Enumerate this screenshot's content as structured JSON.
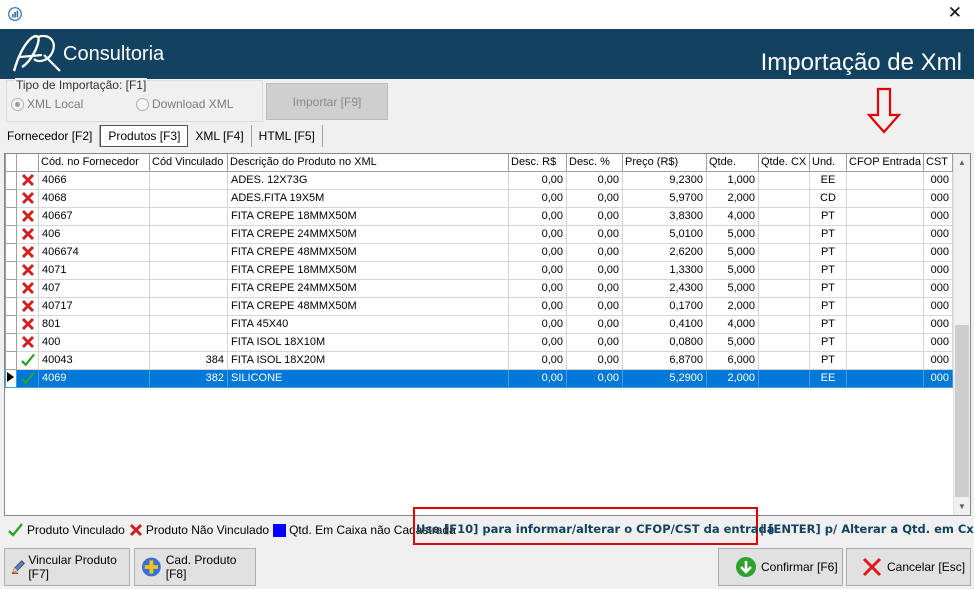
{
  "window": {
    "close_glyph": "✕"
  },
  "banner": {
    "brand": "Consultoria",
    "title": "Importação de Xml"
  },
  "import_group": {
    "legend": "Tipo de Importação: [F1]",
    "options": [
      "XML Local",
      "Download XML"
    ],
    "selected": "XML Local",
    "button": "Importar [F9]"
  },
  "tabs": [
    "Fornecedor [F2]",
    "Produtos [F3]",
    "XML [F4]",
    "HTML [F5]"
  ],
  "active_tab": "Produtos [F3]",
  "grid": {
    "columns": [
      "Cód. no Fornecedor",
      "Cód Vinculado",
      "Descrição do Produto no XML",
      "Desc. R$",
      "Desc. %",
      "Preço (R$)",
      "Qtde.",
      "Qtde. CX",
      "Und.",
      "CFOP Entrada",
      "CST"
    ],
    "rows": [
      {
        "status": "nao-vinculado",
        "cod": "4066",
        "vinc": "",
        "desc": "ADES. 12X73G",
        "desc_rs": "0,00",
        "desc_pct": "0,00",
        "preco": "9,2300",
        "qtde": "1,000",
        "qtde_cx": "",
        "und": "EE",
        "cfop": "",
        "cst": "000"
      },
      {
        "status": "nao-vinculado",
        "cod": "4068",
        "vinc": "",
        "desc": "ADES.FITA 19X5M",
        "desc_rs": "0,00",
        "desc_pct": "0,00",
        "preco": "5,9700",
        "qtde": "2,000",
        "qtde_cx": "",
        "und": "CD",
        "cfop": "",
        "cst": "000"
      },
      {
        "status": "nao-vinculado",
        "cod": "40667",
        "vinc": "",
        "desc": "FITA CREPE 18MMX50M",
        "desc_rs": "0,00",
        "desc_pct": "0,00",
        "preco": "3,8300",
        "qtde": "4,000",
        "qtde_cx": "",
        "und": "PT",
        "cfop": "",
        "cst": "000"
      },
      {
        "status": "nao-vinculado",
        "cod": "406",
        "vinc": "",
        "desc": "FITA CREPE 24MMX50M",
        "desc_rs": "0,00",
        "desc_pct": "0,00",
        "preco": "5,0100",
        "qtde": "5,000",
        "qtde_cx": "",
        "und": "PT",
        "cfop": "",
        "cst": "000"
      },
      {
        "status": "nao-vinculado",
        "cod": "406674",
        "vinc": "",
        "desc": "FITA CREPE 48MMX50M",
        "desc_rs": "0,00",
        "desc_pct": "0,00",
        "preco": "2,6200",
        "qtde": "5,000",
        "qtde_cx": "",
        "und": "PT",
        "cfop": "",
        "cst": "000"
      },
      {
        "status": "nao-vinculado",
        "cod": "4071",
        "vinc": "",
        "desc": "FITA CREPE 18MMX50M",
        "desc_rs": "0,00",
        "desc_pct": "0,00",
        "preco": "1,3300",
        "qtde": "5,000",
        "qtde_cx": "",
        "und": "PT",
        "cfop": "",
        "cst": "000"
      },
      {
        "status": "nao-vinculado",
        "cod": "407",
        "vinc": "",
        "desc": "FITA CREPE 24MMX50M",
        "desc_rs": "0,00",
        "desc_pct": "0,00",
        "preco": "2,4300",
        "qtde": "5,000",
        "qtde_cx": "",
        "und": "PT",
        "cfop": "",
        "cst": "000"
      },
      {
        "status": "nao-vinculado",
        "cod": "40717",
        "vinc": "",
        "desc": "FITA CREPE 48MMX50M",
        "desc_rs": "0,00",
        "desc_pct": "0,00",
        "preco": "0,1700",
        "qtde": "2,000",
        "qtde_cx": "",
        "und": "PT",
        "cfop": "",
        "cst": "000"
      },
      {
        "status": "nao-vinculado",
        "cod": "801",
        "vinc": "",
        "desc": "FITA 45X40",
        "desc_rs": "0,00",
        "desc_pct": "0,00",
        "preco": "0,4100",
        "qtde": "4,000",
        "qtde_cx": "",
        "und": "PT",
        "cfop": "",
        "cst": "000"
      },
      {
        "status": "nao-vinculado",
        "cod": "400",
        "vinc": "",
        "desc": "FITA ISOL 18X10M",
        "desc_rs": "0,00",
        "desc_pct": "0,00",
        "preco": "0,0800",
        "qtde": "5,000",
        "qtde_cx": "",
        "und": "PT",
        "cfop": "",
        "cst": "000"
      },
      {
        "status": "vinculado",
        "cod": "40043",
        "vinc": "384",
        "desc": "FITA ISOL 18X20M",
        "desc_rs": "0,00",
        "desc_pct": "0,00",
        "preco": "6,8700",
        "qtde": "6,000",
        "qtde_cx": "",
        "und": "PT",
        "cfop": "",
        "cst": "000"
      },
      {
        "status": "vinculado",
        "cod": "4069",
        "vinc": "382",
        "desc": "SILICONE",
        "desc_rs": "0,00",
        "desc_pct": "0,00",
        "preco": "5,2900",
        "qtde": "2,000",
        "qtde_cx": "",
        "und": "EE",
        "cfop": "",
        "cst": "000",
        "selected": true
      }
    ]
  },
  "legend": {
    "vinculado": "Produto Vinculado",
    "nao_vinculado": "Produto Não Vinculado",
    "caixa": "Qtd. Em Caixa não Cadastrada"
  },
  "hints": {
    "f10": "Use [F10] para informar/alterar o CFOP/CST da entrada",
    "enter": "| [ENTER] p/ Alterar a Qtd. em Cx."
  },
  "buttons": {
    "vincular": "Vincular Produto [F7]",
    "cadastrar": "Cad. Produto [F8]",
    "confirmar": "Confirmar [F6]",
    "cancelar": "Cancelar [Esc]"
  },
  "colors": {
    "banner": "#12425f",
    "selection": "#0078d7",
    "annotation_red": "#e00000",
    "check_green": "#2ea12e",
    "x_red": "#d0201f"
  },
  "icons": [
    "bar-chart-icon",
    "close-icon",
    "logo-icon",
    "down-arrow-annotation",
    "x-icon",
    "check-icon",
    "pencil-icon",
    "plus-icon",
    "confirm-icon",
    "cancel-icon"
  ]
}
